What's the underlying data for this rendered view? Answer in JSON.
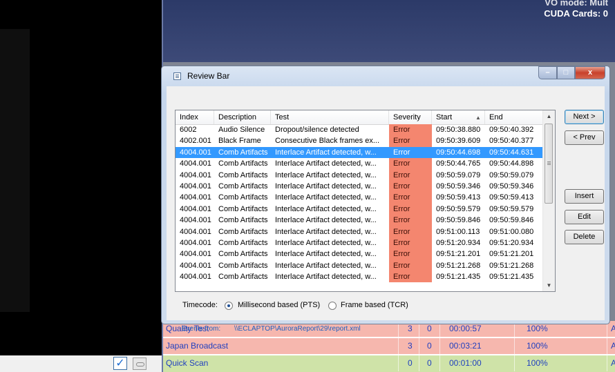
{
  "app_status": {
    "vo_mode": "VO mode: Mult",
    "cuda": "CUDA Cards: 0"
  },
  "window": {
    "title": "Review Bar",
    "controls": {
      "minimize": "–",
      "maximize": "□",
      "close": "x"
    }
  },
  "table": {
    "columns": [
      "Index",
      "Description",
      "Test",
      "Severity",
      "Start",
      "End"
    ],
    "sorted_column": "Start",
    "rows": [
      {
        "index": "6002",
        "description": "Audio Silence",
        "test": "Dropout/silence detected",
        "severity": "Error",
        "start": "09:50:38.880",
        "end": "09:50:40.392"
      },
      {
        "index": "4002.001",
        "description": "Black Frame",
        "test": "Consecutive Black frames ex...",
        "severity": "Error",
        "start": "09:50:39.609",
        "end": "09:50:40.377"
      },
      {
        "index": "4004.001",
        "description": "Comb Artifacts",
        "test": "Interlace Artifact detected, w...",
        "severity": "Error",
        "start": "09:50:44.698",
        "end": "09:50:44.631"
      },
      {
        "index": "4004.001",
        "description": "Comb Artifacts",
        "test": "Interlace Artifact detected, w...",
        "severity": "Error",
        "start": "09:50:44.765",
        "end": "09:50:44.898"
      },
      {
        "index": "4004.001",
        "description": "Comb Artifacts",
        "test": "Interlace Artifact detected, w...",
        "severity": "Error",
        "start": "09:50:59.079",
        "end": "09:50:59.079"
      },
      {
        "index": "4004.001",
        "description": "Comb Artifacts",
        "test": "Interlace Artifact detected, w...",
        "severity": "Error",
        "start": "09:50:59.346",
        "end": "09:50:59.346"
      },
      {
        "index": "4004.001",
        "description": "Comb Artifacts",
        "test": "Interlace Artifact detected, w...",
        "severity": "Error",
        "start": "09:50:59.413",
        "end": "09:50:59.413"
      },
      {
        "index": "4004.001",
        "description": "Comb Artifacts",
        "test": "Interlace Artifact detected, w...",
        "severity": "Error",
        "start": "09:50:59.579",
        "end": "09:50:59.579"
      },
      {
        "index": "4004.001",
        "description": "Comb Artifacts",
        "test": "Interlace Artifact detected, w...",
        "severity": "Error",
        "start": "09:50:59.846",
        "end": "09:50:59.846"
      },
      {
        "index": "4004.001",
        "description": "Comb Artifacts",
        "test": "Interlace Artifact detected, w...",
        "severity": "Error",
        "start": "09:51:00.113",
        "end": "09:51:00.080"
      },
      {
        "index": "4004.001",
        "description": "Comb Artifacts",
        "test": "Interlace Artifact detected, w...",
        "severity": "Error",
        "start": "09:51:20.934",
        "end": "09:51:20.934"
      },
      {
        "index": "4004.001",
        "description": "Comb Artifacts",
        "test": "Interlace Artifact detected, w...",
        "severity": "Error",
        "start": "09:51:21.201",
        "end": "09:51:21.201"
      },
      {
        "index": "4004.001",
        "description": "Comb Artifacts",
        "test": "Interlace Artifact detected, w...",
        "severity": "Error",
        "start": "09:51:21.268",
        "end": "09:51:21.268"
      },
      {
        "index": "4004.001",
        "description": "Comb Artifacts",
        "test": "Interlace Artifact detected, w...",
        "severity": "Error",
        "start": "09:51:21.435",
        "end": "09:51:21.435"
      }
    ]
  },
  "buttons": {
    "next": "Next >",
    "prev": "< Prev",
    "insert": "Insert",
    "edit": "Edit",
    "delete": "Delete"
  },
  "timecode": {
    "label": "Timecode:",
    "options": [
      "Millisecond based (PTS)",
      "Frame based (TCR)"
    ],
    "selected": "Millisecond based (PTS)"
  },
  "events": {
    "label": "Events from:",
    "path": "\\\\ECLAPTOP\\AuroraReport\\29\\report.xml"
  },
  "jobs": [
    {
      "name": "Quality Test",
      "errors": "3",
      "warnings": "0",
      "duration": "00:00:57",
      "progress": "100%",
      "extra": "A"
    },
    {
      "name": "Japan Broadcast",
      "errors": "3",
      "warnings": "0",
      "duration": "00:03:21",
      "progress": "100%",
      "extra": "A"
    },
    {
      "name": "Quick Scan",
      "errors": "0",
      "warnings": "0",
      "duration": "00:01:00",
      "progress": "100%",
      "extra": "A"
    }
  ],
  "colors": {
    "error_cell": "#f4866f",
    "selected_row": "#3399ff",
    "job_red": "#f6b7ae",
    "job_green": "#cfe3a8",
    "title_bar": "#c5d6ec"
  }
}
